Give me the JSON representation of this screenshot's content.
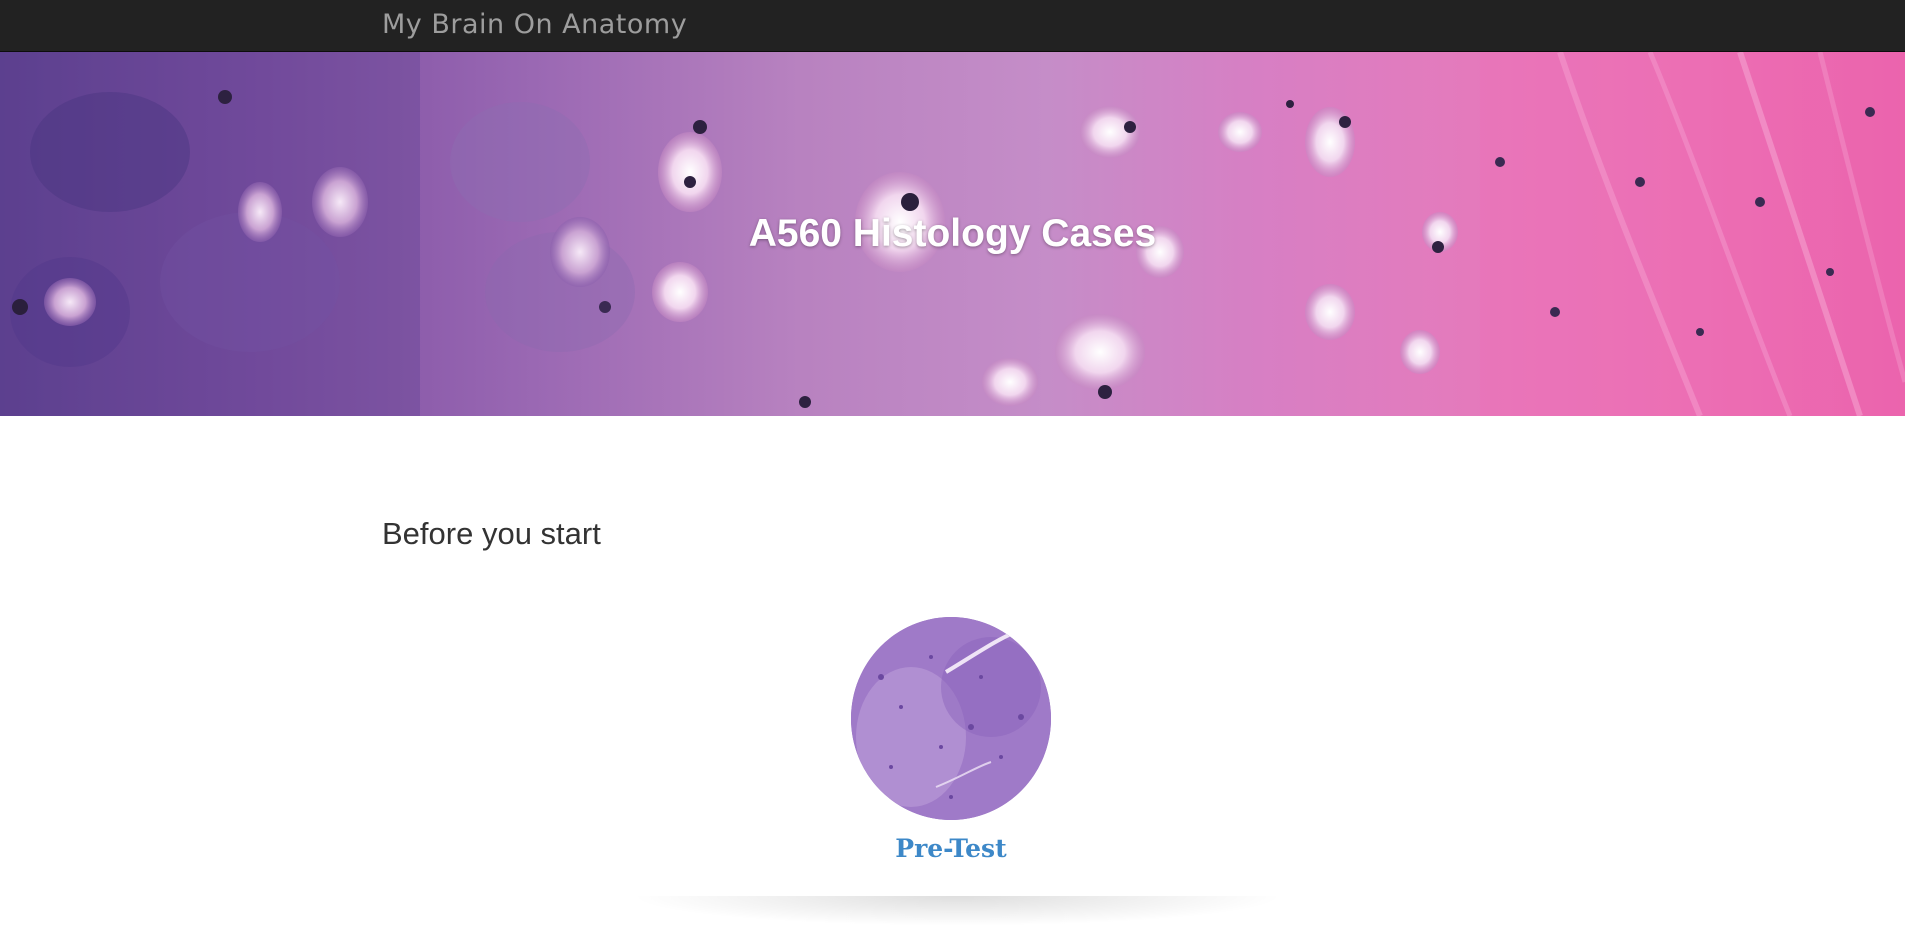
{
  "navbar": {
    "brand": "My Brain On Anatomy",
    "background_color": "#222222",
    "brand_color": "#9d9d9d"
  },
  "hero": {
    "title": "A560 Histology Cases",
    "image": "histology-tissue-banner"
  },
  "main": {
    "section_heading": "Before you start",
    "cards": [
      {
        "label": "Pre-Test",
        "image": "histology-circle-thumbnail",
        "label_color": "#3d88c8"
      }
    ]
  }
}
